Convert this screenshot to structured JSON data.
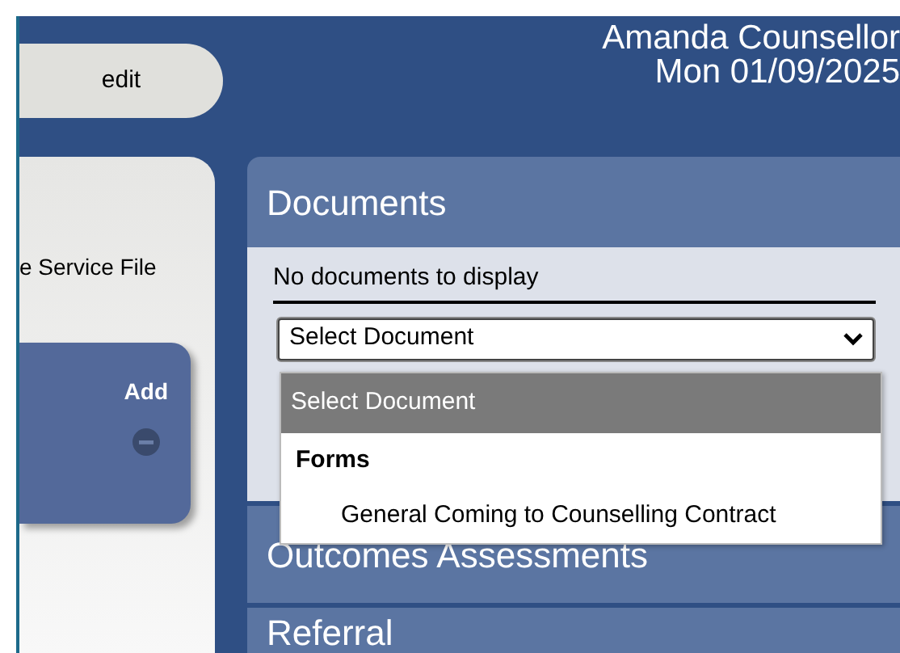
{
  "header": {
    "user": "Amanda Counsellor",
    "date": "Mon 01/09/2025"
  },
  "edit_button": "edit",
  "left_panel": {
    "text": "e Service File",
    "card": {
      "action": "Add"
    }
  },
  "documents": {
    "title": "Documents",
    "empty_message": "No documents to display",
    "select": {
      "value": "Select Document",
      "expanded": true,
      "options": [
        {
          "kind": "option",
          "label": "Select Document",
          "selected": true
        },
        {
          "kind": "group",
          "label": "Forms"
        },
        {
          "kind": "option",
          "label": "General Coming to Counselling Contract",
          "selected": false
        }
      ]
    }
  },
  "sections": [
    "Outcomes Assessments",
    "Referral"
  ]
}
